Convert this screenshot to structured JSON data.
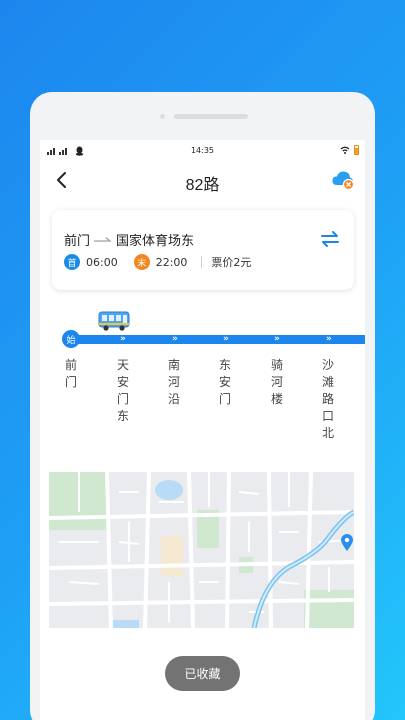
{
  "status_bar": {
    "time": "14:35"
  },
  "nav": {
    "title": "82路"
  },
  "route": {
    "from": "前门",
    "to": "国家体育场东",
    "first_badge": "首",
    "first_time": "06:00",
    "last_badge": "末",
    "last_time": "22:00",
    "fare": "票价2元"
  },
  "line": {
    "start_badge": "始",
    "stops": [
      "前门",
      "天安门东",
      "南河沿",
      "东安门",
      "骑河楼",
      "沙滩路口北"
    ]
  },
  "toast": {
    "text": "已收藏"
  },
  "colors": {
    "primary": "#1d86ee",
    "orange": "#f4871f",
    "background_gradient_end": "#23c6fb"
  }
}
